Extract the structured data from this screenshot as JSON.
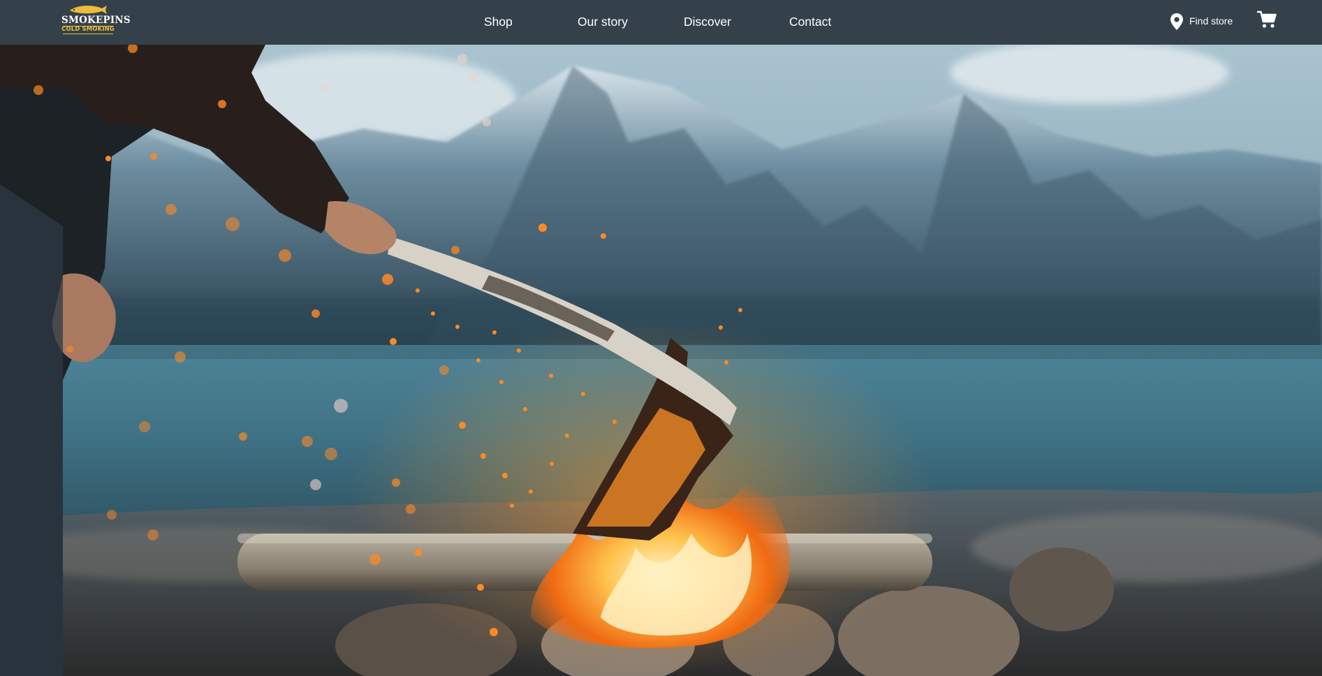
{
  "brand": {
    "name": "SMOKEPINS",
    "tagline": "COLD SMOKING",
    "text_color": "#ffffff",
    "accent_color": "#ebbd3c"
  },
  "nav": {
    "background": "#34414b",
    "links": [
      {
        "label": "Shop"
      },
      {
        "label": "Our story"
      },
      {
        "label": "Discover"
      },
      {
        "label": "Contact"
      }
    ],
    "find_store": {
      "label": "Find store",
      "icon": "map-pin-icon"
    },
    "cart": {
      "icon": "shopping-cart-icon"
    }
  },
  "hero": {
    "image_alt": "Campfire on a lakeshore with snowy mountains, a person stoking the fire with a stick"
  }
}
